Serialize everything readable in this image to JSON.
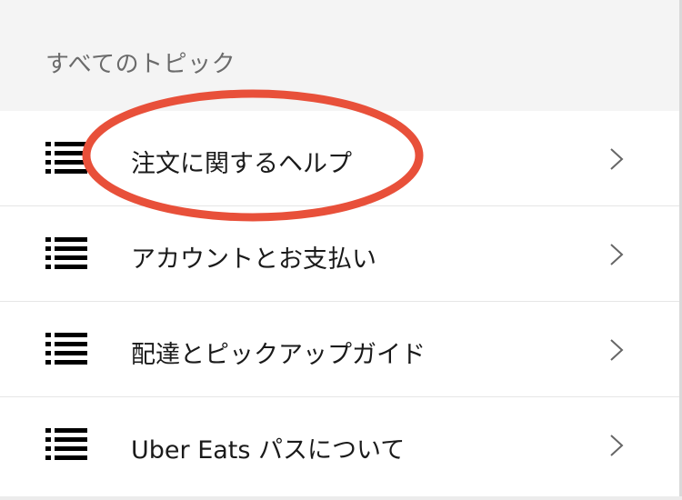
{
  "section": {
    "title": "すべてのトピック"
  },
  "topics": [
    {
      "label": "注文に関するヘルプ",
      "icon": "list-icon"
    },
    {
      "label": "アカウントとお支払い",
      "icon": "list-icon"
    },
    {
      "label": "配達とピックアップガイド",
      "icon": "list-icon"
    },
    {
      "label": "Uber Eats パスについて",
      "icon": "list-icon"
    }
  ],
  "colors": {
    "header_bg": "#f4f4f4",
    "annotation_red": "#e8503a",
    "text_primary": "#1a1a1a",
    "text_secondary": "#6b6b6b"
  }
}
